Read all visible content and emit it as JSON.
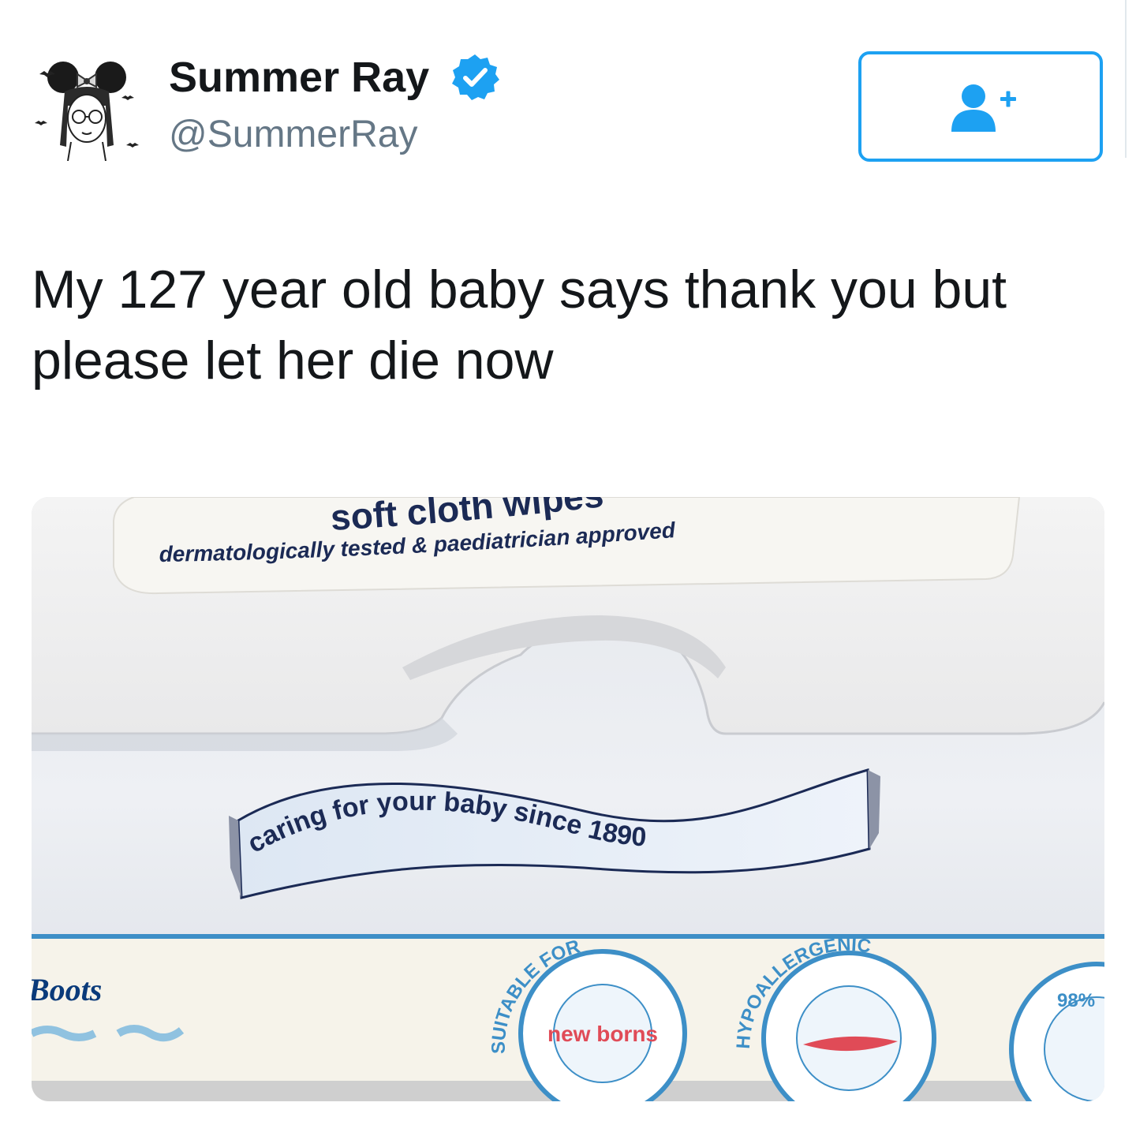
{
  "author": {
    "name": "Summer Ray",
    "handle": "@SummerRay",
    "verified": true,
    "avatar_icon": "avatar-illustration-icon"
  },
  "follow_button": {
    "icon": "follow-user-icon",
    "color": "#1da1f2"
  },
  "tweet": {
    "text": "My 127 year old baby says thank you but please let her die now"
  },
  "photo": {
    "label_top": "soft cloth wipes",
    "label_subline": "dermatologically tested & paediatrician approved",
    "ribbon_text": "caring for your baby since 1890",
    "brand": "Boots",
    "badge_1_ring": "SUITABLE FOR",
    "badge_1_center": "new borns",
    "badge_2_ring": "HYPOALLERGENIC",
    "badge_3_partial": "98%"
  },
  "colors": {
    "text_primary": "#14171a",
    "text_secondary": "#657786",
    "accent": "#1da1f2",
    "package_blue": "#3d8fc7",
    "ribbon_text": "#1b2a55"
  }
}
